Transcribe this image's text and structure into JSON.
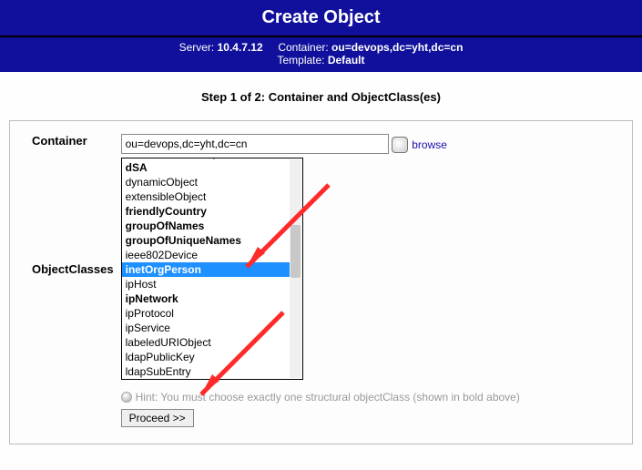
{
  "title": "Create Object",
  "info": {
    "server_label": "Server:",
    "server_value": "10.4.7.12",
    "container_label": "Container:",
    "container_value": "ou=devops,dc=yht,dc=cn",
    "template_label": "Template:",
    "template_value": "Default"
  },
  "step": "Step 1 of 2: Container and ObjectClass(es)",
  "form": {
    "container_label": "Container",
    "container_value": "ou=devops,dc=yht,dc=cn",
    "browse_label": "browse",
    "objectclasses_label": "ObjectClasses",
    "options": [
      {
        "text": "domainRelatedObject",
        "bold": false,
        "selected": false
      },
      {
        "text": "dSA",
        "bold": true,
        "selected": false
      },
      {
        "text": "dynamicObject",
        "bold": false,
        "selected": false
      },
      {
        "text": "extensibleObject",
        "bold": false,
        "selected": false
      },
      {
        "text": "friendlyCountry",
        "bold": true,
        "selected": false
      },
      {
        "text": "groupOfNames",
        "bold": true,
        "selected": false
      },
      {
        "text": "groupOfUniqueNames",
        "bold": true,
        "selected": false
      },
      {
        "text": "ieee802Device",
        "bold": false,
        "selected": false
      },
      {
        "text": "inetOrgPerson",
        "bold": true,
        "selected": true
      },
      {
        "text": "ipHost",
        "bold": false,
        "selected": false
      },
      {
        "text": "ipNetwork",
        "bold": true,
        "selected": false
      },
      {
        "text": "ipProtocol",
        "bold": false,
        "selected": false
      },
      {
        "text": "ipService",
        "bold": false,
        "selected": false
      },
      {
        "text": "labeledURIObject",
        "bold": false,
        "selected": false
      },
      {
        "text": "ldapPublicKey",
        "bold": false,
        "selected": false
      },
      {
        "text": "ldapSubEntry",
        "bold": false,
        "selected": false
      }
    ],
    "hint": "Hint: You must choose exactly one structural objectClass (shown in bold above)",
    "proceed_label": "Proceed >>"
  }
}
